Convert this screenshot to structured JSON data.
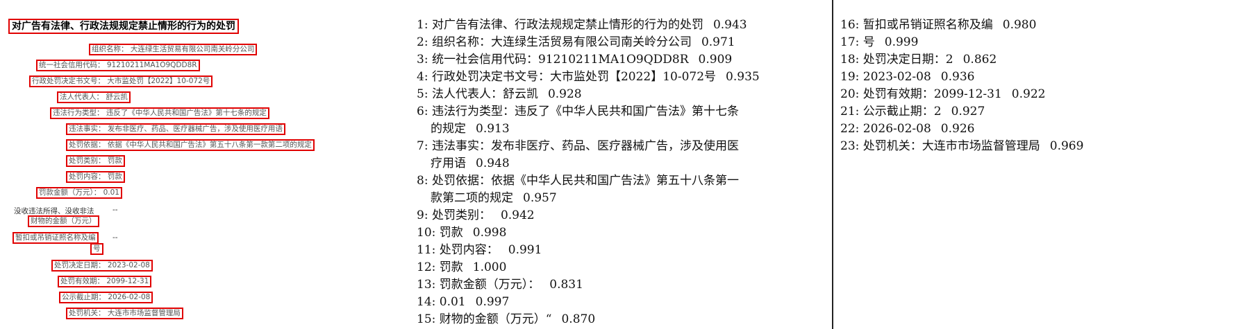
{
  "left": {
    "title": "对广告有法律、行政法规规定禁止情形的行为的处罚",
    "fields": [
      {
        "text": "组织名称： 大连绿生活贸易有限公司南关岭分公司"
      },
      {
        "text": "统一社会信用代码： 91210211MA1O9QDD8R"
      },
      {
        "text": "行政处罚决定书文号： 大市监处罚【2022】10-072号"
      },
      {
        "text": "法人代表人： 舒云凯"
      },
      {
        "text": "违法行为类型： 违反了《中华人民共和国广告法》第十七条的规定"
      },
      {
        "text": "违法事实： 发布非医疗、药品、医疗器械广告，涉及使用医疗用语"
      },
      {
        "text": "处罚依据： 依据《中华人民共和国广告法》第五十八条第一款第二项的规定"
      },
      {
        "text": "处罚类别： 罚款"
      },
      {
        "text": "处罚内容： 罚款"
      },
      {
        "text": "罚款金额（万元）： 0.01"
      },
      {
        "text": "没收违法所得、没收非法"
      },
      {
        "text": "--"
      },
      {
        "text": "财物的金额（万元）"
      },
      {
        "text": "暂扣或吊销证照名称及编"
      },
      {
        "text": "--"
      },
      {
        "text": "号"
      },
      {
        "text": "处罚决定日期： 2023-02-08"
      },
      {
        "text": "处罚有效期： 2099-12-31"
      },
      {
        "text": "公示截止期： 2026-02-08"
      },
      {
        "text": "处罚机关： 大连市市场监督管理局"
      }
    ]
  },
  "results_middle": [
    {
      "idx": "1:",
      "text": "对广告有法律、行政法规规定禁止情形的行为的处罚",
      "score": "0.943"
    },
    {
      "idx": "2:",
      "text": "组织名称：大连绿生活贸易有限公司南关岭分公司",
      "score": "0.971"
    },
    {
      "idx": "3:",
      "text": "统一社会信用代码：91210211MA1O9QDD8R",
      "score": "0.909"
    },
    {
      "idx": "4:",
      "text": "行政处罚决定书文号：大市监处罚【2022】10-072号",
      "score": "0.935"
    },
    {
      "idx": "5:",
      "text": "法人代表人：舒云凯",
      "score": "0.928"
    },
    {
      "idx": "6:",
      "text": "违法行为类型：违反了《中华人民共和国广告法》第十七条",
      "score": ""
    },
    {
      "idx": "",
      "text": "的规定",
      "score": "0.913"
    },
    {
      "idx": "7:",
      "text": "违法事实：发布非医疗、药品、医疗器械广告，涉及使用医",
      "score": ""
    },
    {
      "idx": "",
      "text": "疗用语",
      "score": "0.948"
    },
    {
      "idx": "8:",
      "text": "处罚依据：依据《中华人民共和国广告法》第五十八条第一",
      "score": ""
    },
    {
      "idx": "",
      "text": "款第二项的规定",
      "score": "0.957"
    },
    {
      "idx": "9:",
      "text": "处罚类别：",
      "score": "0.942"
    },
    {
      "idx": "10:",
      "text": "罚款",
      "score": "0.998"
    },
    {
      "idx": "11:",
      "text": "处罚内容：",
      "score": "0.991"
    },
    {
      "idx": "12:",
      "text": "罚款",
      "score": "1.000"
    },
    {
      "idx": "13:",
      "text": "罚款金额（万元）：",
      "score": "0.831"
    },
    {
      "idx": "14:",
      "text": "0.01",
      "score": "0.997"
    },
    {
      "idx": "15:",
      "text": "财物的金额（万元）“",
      "score": "0.870"
    }
  ],
  "results_right": [
    {
      "idx": "16:",
      "text": "暂扣或吊销证照名称及编",
      "score": "0.980"
    },
    {
      "idx": "17:",
      "text": "号",
      "score": "0.999"
    },
    {
      "idx": "18:",
      "text": "处罚决定日期：2",
      "score": "0.862"
    },
    {
      "idx": "19:",
      "text": "2023-02-08",
      "score": "0.936"
    },
    {
      "idx": "20:",
      "text": "处罚有效期：2099-12-31",
      "score": "0.922"
    },
    {
      "idx": "21:",
      "text": "公示截止期：2",
      "score": "0.927"
    },
    {
      "idx": "22:",
      "text": "2026-02-08",
      "score": "0.926"
    },
    {
      "idx": "23:",
      "text": "处罚机关：大连市市场监督管理局",
      "score": "0.969"
    }
  ],
  "colors": {
    "box": "#e00000",
    "divider": "#222222"
  }
}
